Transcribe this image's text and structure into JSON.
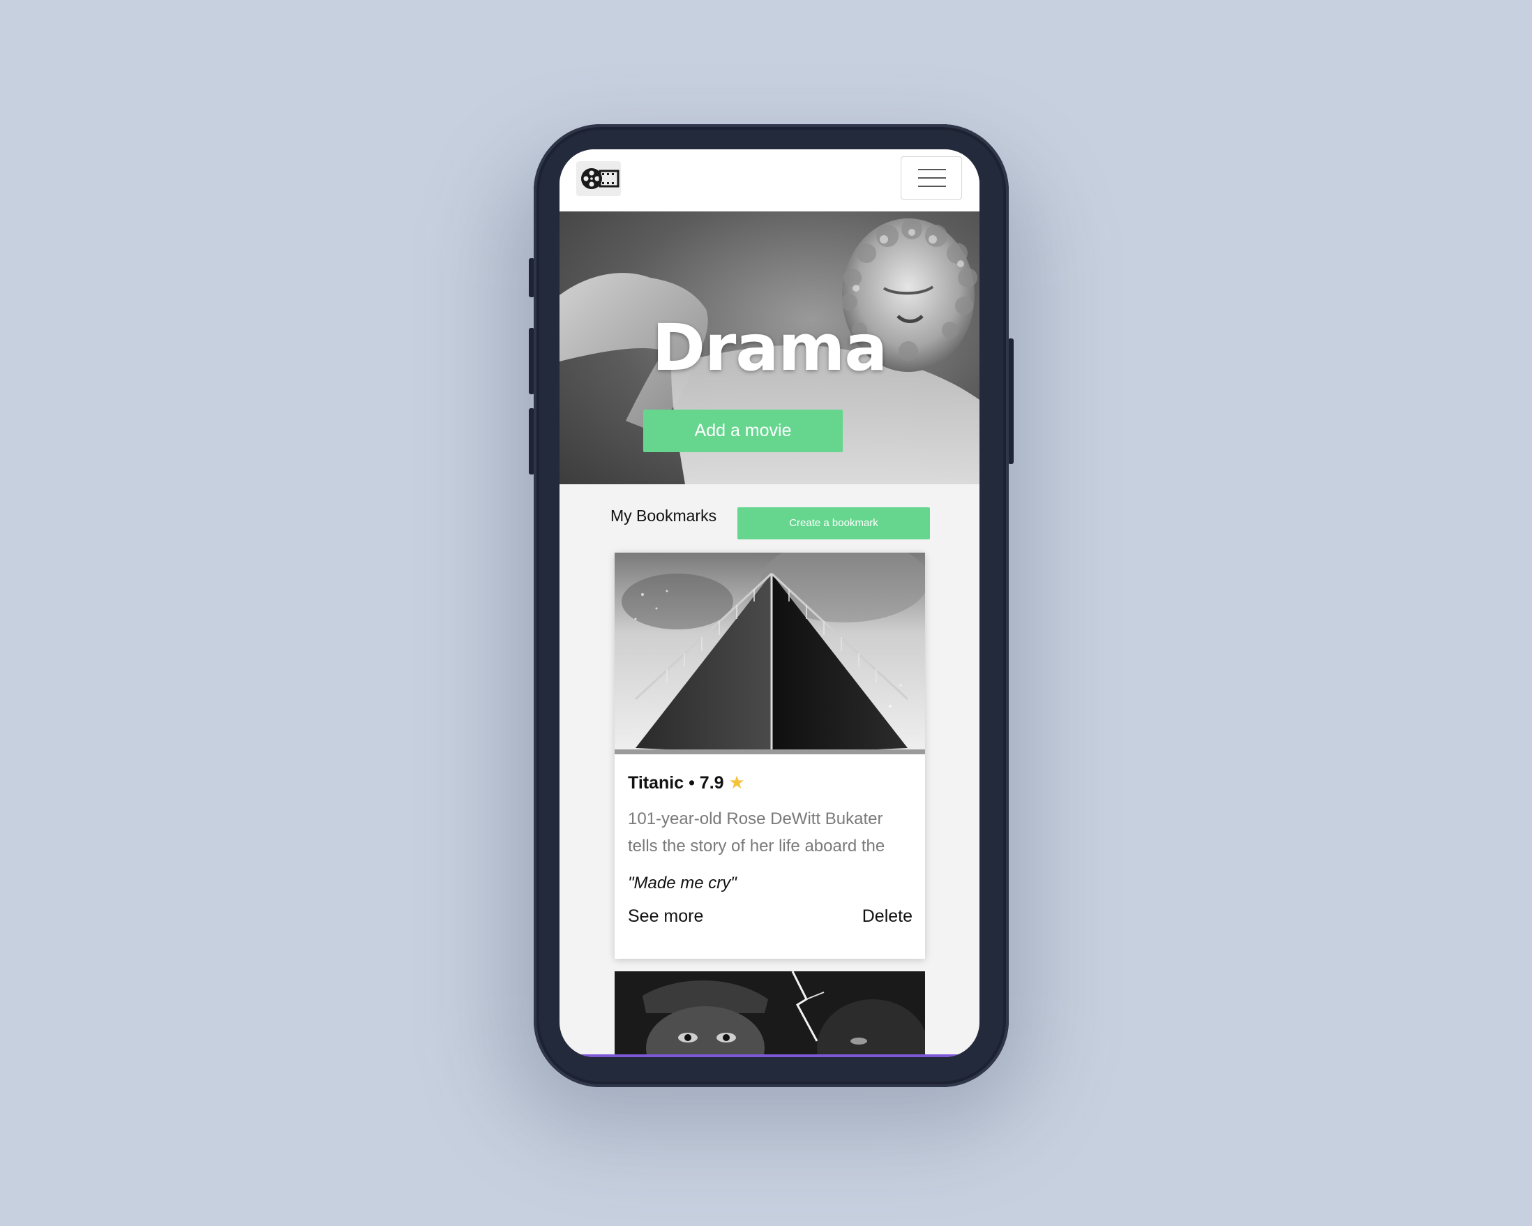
{
  "colors": {
    "background": "#c7d0df",
    "device": "#232a3b",
    "accent_green": "#66d68f",
    "star": "#f4c33a",
    "bottom_bar": "#7f58d6"
  },
  "navbar": {
    "logo_icon": "film-reel-icon",
    "menu_icon": "hamburger-menu-icon"
  },
  "hero": {
    "title": "Drama",
    "button_label": "Add a movie"
  },
  "bookmarks": {
    "title": "My Bookmarks",
    "create_label": "Create a bookmark",
    "items": [
      {
        "title": "Titanic",
        "separator": "•",
        "rating": "7.9",
        "rating_icon": "star-icon",
        "description": "101-year-old Rose DeWitt Bukater tells the story of her life aboard the",
        "quote": "\"Made me cry\"",
        "see_more_label": "See more",
        "delete_label": "Delete"
      }
    ]
  }
}
